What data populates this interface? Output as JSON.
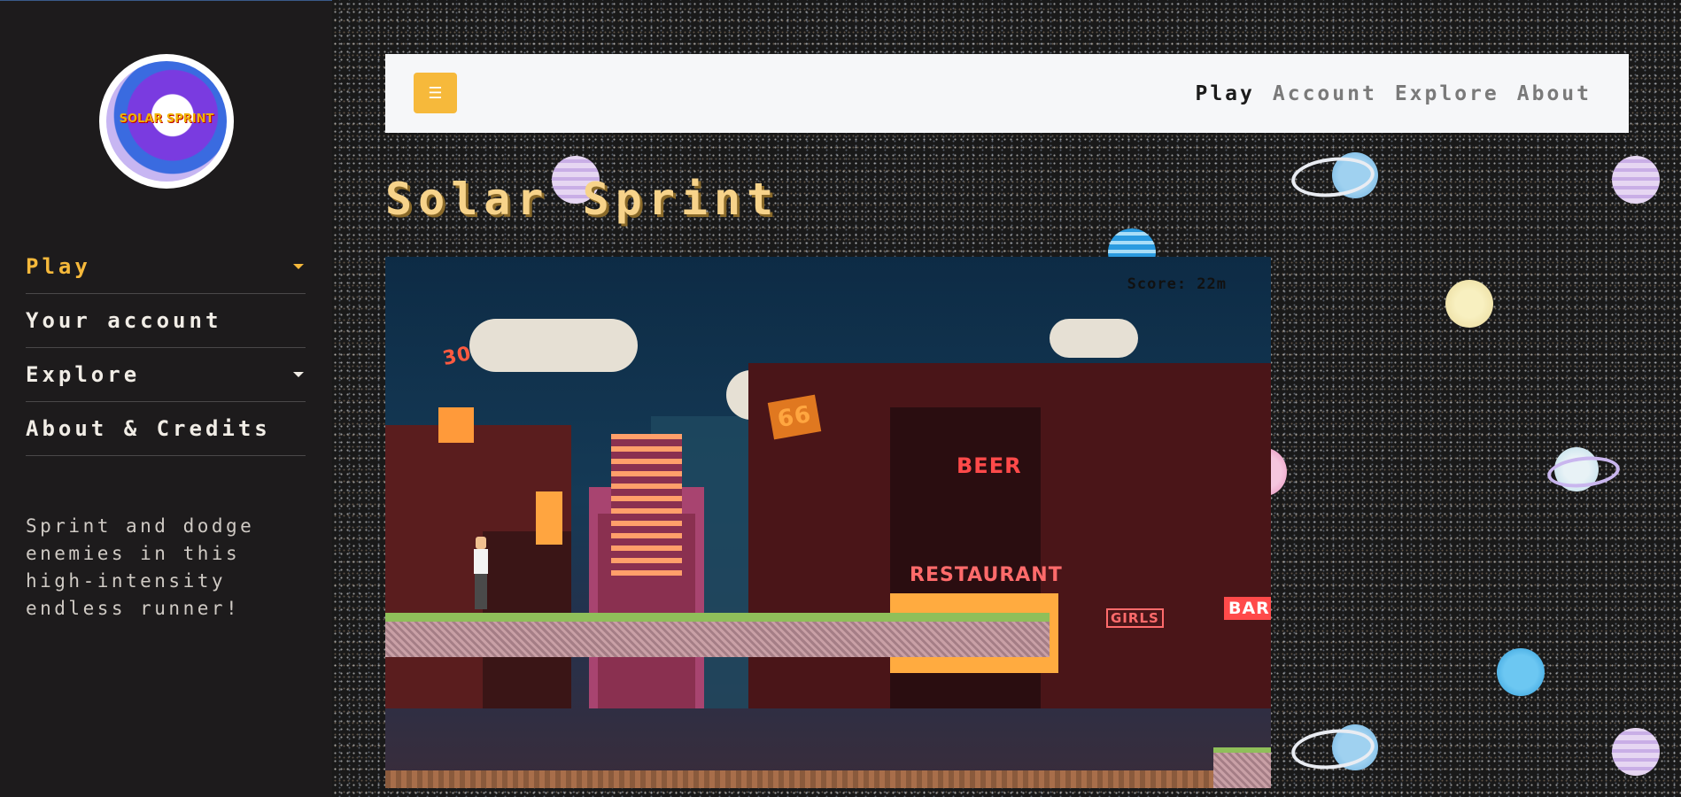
{
  "sidebar": {
    "logo_text": "SOLAR SPRINT",
    "nav": [
      {
        "label": "Play",
        "active": true,
        "has_dropdown": true
      },
      {
        "label": "Your account",
        "active": false,
        "has_dropdown": false
      },
      {
        "label": "Explore",
        "active": false,
        "has_dropdown": true
      },
      {
        "label": "About & Credits",
        "active": false,
        "has_dropdown": false
      }
    ],
    "tagline": "Sprint and dodge enemies in this high-intensity endless runner!"
  },
  "navbar": {
    "menu_icon": "hamburger-icon",
    "links": [
      {
        "label": "Play",
        "current": true
      },
      {
        "label": "Account",
        "current": false
      },
      {
        "label": "Explore",
        "current": false
      },
      {
        "label": "About",
        "current": false
      }
    ]
  },
  "page": {
    "title": "Solar Sprint"
  },
  "game": {
    "score_text": "Score: 22m",
    "signs": {
      "sign_30": "30",
      "sign_66": "66",
      "beer": "BEER",
      "restaurant": "RESTAURANT",
      "girls": "GIRLS",
      "bar": "BAR"
    }
  },
  "colors": {
    "accent": "#f6b93b",
    "sidebar_bg": "#1d1b1c",
    "title": "#f7d38a",
    "navbar_bg": "#f6f7f9"
  }
}
